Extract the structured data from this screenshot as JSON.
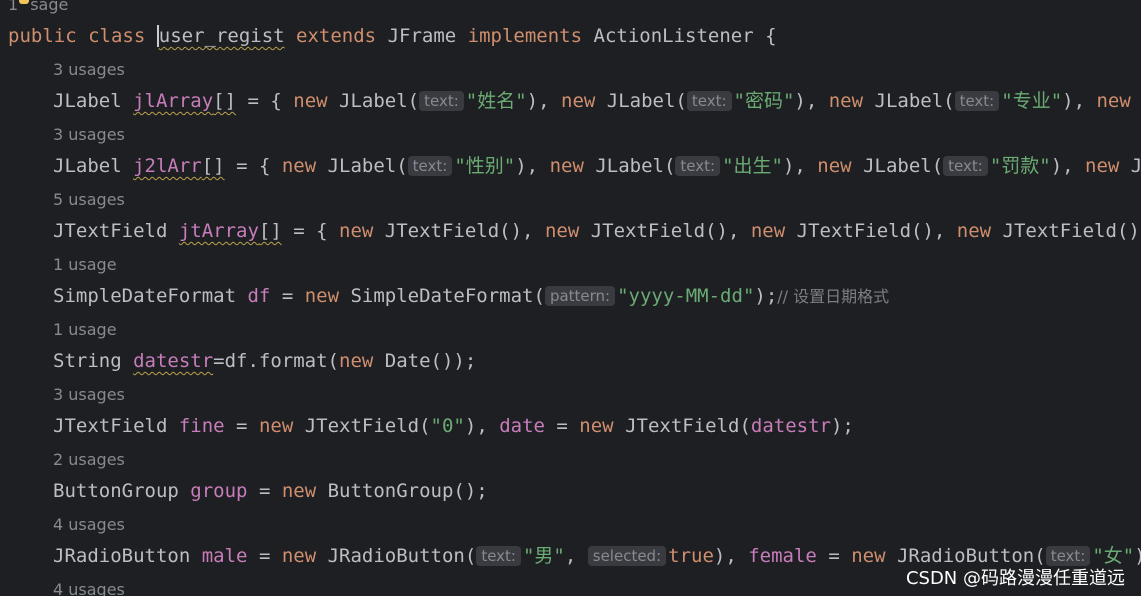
{
  "usages": {
    "top_prefix": "1",
    "top_suffix": "sage",
    "u1": "3 usages",
    "u2": "3 usages",
    "u3": "5 usages",
    "u4": "1 usage",
    "u5": "1 usage",
    "u6": "3 usages",
    "u7": "2 usages",
    "u8": "4 usages",
    "u9": "4 usages"
  },
  "code": {
    "l1": {
      "public": "public",
      "class": "class",
      "name": "user_regist",
      "extends": "extends",
      "super": "JFrame",
      "implements": "implements",
      "iface": "ActionListener",
      "brace": " {"
    },
    "l2": {
      "type": "JLabel",
      "var": "jlArray",
      "arr": "[]",
      "eq": " = { ",
      "new1": "new",
      "ctor1": " JLabel(",
      "hint1": "text:",
      "s1": "\"姓名\"",
      "sep1": "), ",
      "new2": "new",
      "ctor2": " JLabel(",
      "hint2": "text:",
      "s2": "\"密码\"",
      "sep2": "), ",
      "new3": "new",
      "ctor3": " JLabel(",
      "hint3": "text:",
      "s3": "\"专业\"",
      "sep3": "), ",
      "new4": "new",
      "tail": " JL"
    },
    "l3": {
      "type": "JLabel",
      "var": "j2lArr",
      "arr": "[]",
      "eq": " = { ",
      "new1": "new",
      "ctor1": " JLabel(",
      "hint1": "text:",
      "s1": "\"性别\"",
      "sep1": "), ",
      "new2": "new",
      "ctor2": " JLabel(",
      "hint2": "text:",
      "s2": "\"出生\"",
      "sep2": "), ",
      "new3": "new",
      "ctor3": " JLabel(",
      "hint3": "text:",
      "s3": "\"罚款\"",
      "sep3": "), ",
      "new4": "new",
      "tail": " JLa"
    },
    "l4": {
      "type": "JTextField",
      "var": "jtArray",
      "arr": "[]",
      "eq": " = { ",
      "new1": "new",
      "c1": " JTextField(), ",
      "new2": "new",
      "c2": " JTextField(), ",
      "new3": "new",
      "c3": " JTextField(), ",
      "new4": "new",
      "c4": " JTextField() };"
    },
    "l5": {
      "type": "SimpleDateFormat",
      "var": "df",
      "eq": " = ",
      "new": "new",
      "ctor": " SimpleDateFormat(",
      "hint": "pattern:",
      "str": "\"yyyy-MM-dd\"",
      "end": ");",
      "comment": "// 设置日期格式"
    },
    "l6": {
      "type": "String",
      "var": "datestr",
      "mid": "=df.format(",
      "new": "new",
      "end": " Date());"
    },
    "l7": {
      "type": "JTextField",
      "var1": "fine",
      "eq1": " = ",
      "new1": "new",
      "ctor1": " JTextField(",
      "s1": "\"0\"",
      "mid": "), ",
      "var2": "date",
      "eq2": " = ",
      "new2": "new",
      "ctor2": " JTextField(",
      "arg": "datestr",
      "end": ");"
    },
    "l8": {
      "type": "ButtonGroup",
      "var": "group",
      "eq": " = ",
      "new": "new",
      "end": " ButtonGroup();"
    },
    "l9": {
      "type": "JRadioButton",
      "var1": "male",
      "eq1": " = ",
      "new1": "new",
      "ctor1": " JRadioButton(",
      "hint1": "text:",
      "s1": "\"男\"",
      "sep1": ", ",
      "hint2": "selected:",
      "bool": "true",
      "mid": "), ",
      "var2": "female",
      "eq2": " = ",
      "new2": "new",
      "ctor2": " JRadioButton(",
      "hint3": "text:",
      "s2": "\"女\"",
      "tail": "),"
    }
  },
  "watermark": "CSDN @码路漫漫任重道远",
  "colors": {
    "background": "#1e1f22",
    "keyword": "#cf8e6d",
    "field": "#c77dbb",
    "string": "#6aab73",
    "hint_bg": "#393b40"
  }
}
